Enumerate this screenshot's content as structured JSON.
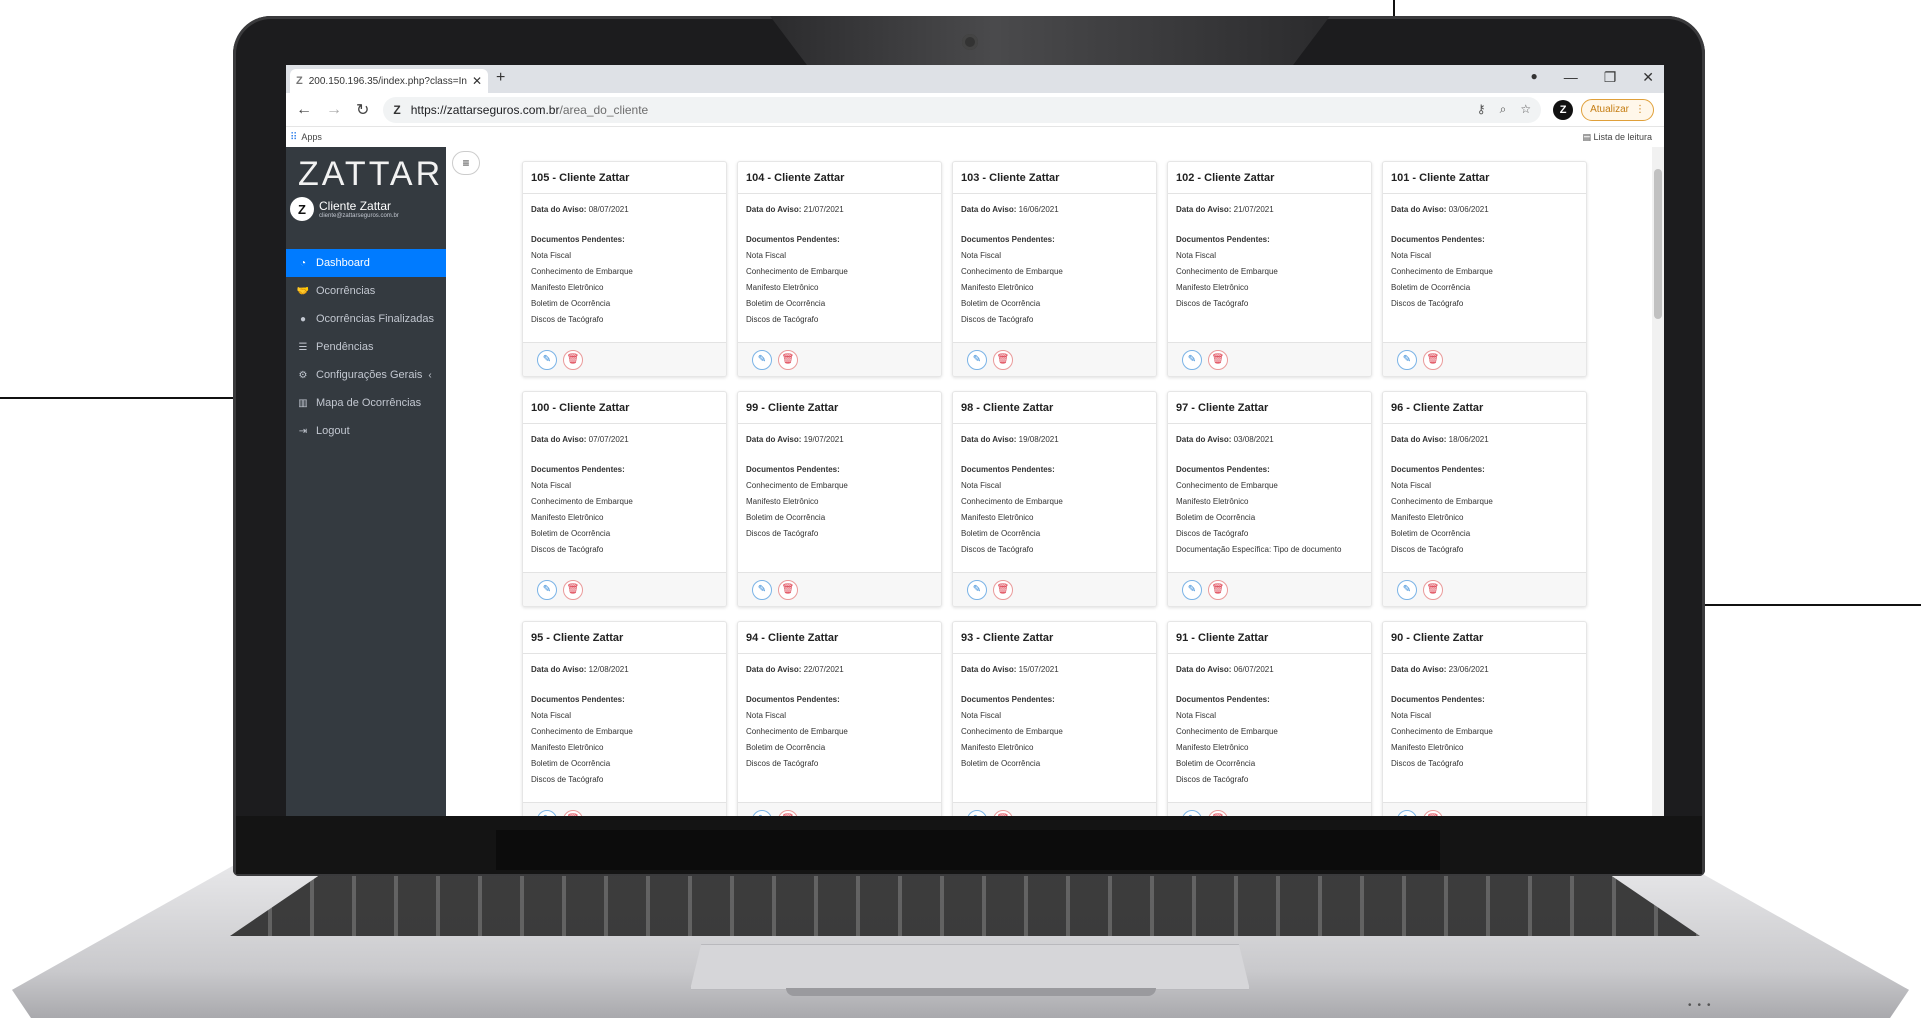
{
  "browser": {
    "tab_title": "200.150.196.35/index.php?class=In",
    "tab_favicon": "Z",
    "new_tab": "+",
    "url_host": "https://zattarseguros.com.br",
    "url_path": "/area_do_cliente",
    "url_favicon": "Z",
    "profile_initial": "Z",
    "update_label": "Atualizar",
    "bookmarks_apps": "Apps",
    "reading_list": "Lista de leitura"
  },
  "sidebar": {
    "brand": "ZATTAR",
    "user_initial": "Z",
    "user_name": "Cliente Zattar",
    "user_email": "cliente@zattarseguros.com.br",
    "items": [
      {
        "label": "Dashboard",
        "icon": "chart-pie-icon",
        "active": true
      },
      {
        "label": "Ocorrências",
        "icon": "handshake-icon"
      },
      {
        "label": "Ocorrências Finalizadas",
        "icon": "circle-icon"
      },
      {
        "label": "Pendências",
        "icon": "list-icon"
      },
      {
        "label": "Configurações Gerais",
        "icon": "gear-icon",
        "chevron": "‹"
      },
      {
        "label": "Mapa de Ocorrências",
        "icon": "map-icon"
      },
      {
        "label": "Logout",
        "icon": "logout-icon"
      }
    ]
  },
  "labels": {
    "date_label": "Data do Aviso:",
    "docs_label": "Documentos Pendentes:"
  },
  "cards": [
    {
      "title": "105 - Cliente Zattar",
      "date": "08/07/2021",
      "docs": [
        "Nota Fiscal",
        "Conhecimento de Embarque",
        "Manifesto Eletrônico",
        "Boletim de Ocorrência",
        "Discos de Tacógrafo"
      ]
    },
    {
      "title": "104 - Cliente Zattar",
      "date": "21/07/2021",
      "docs": [
        "Nota Fiscal",
        "Conhecimento de Embarque",
        "Manifesto Eletrônico",
        "Boletim de Ocorrência",
        "Discos de Tacógrafo"
      ]
    },
    {
      "title": "103 - Cliente Zattar",
      "date": "16/06/2021",
      "docs": [
        "Nota Fiscal",
        "Conhecimento de Embarque",
        "Manifesto Eletrônico",
        "Boletim de Ocorrência",
        "Discos de Tacógrafo"
      ]
    },
    {
      "title": "102 - Cliente Zattar",
      "date": "21/07/2021",
      "docs": [
        "Nota Fiscal",
        "Conhecimento de Embarque",
        "Manifesto Eletrônico",
        "Discos de Tacógrafo"
      ]
    },
    {
      "title": "101 - Cliente Zattar",
      "date": "03/06/2021",
      "docs": [
        "Nota Fiscal",
        "Conhecimento de Embarque",
        "Boletim de Ocorrência",
        "Discos de Tacógrafo"
      ]
    },
    {
      "title": "100 - Cliente Zattar",
      "date": "07/07/2021",
      "docs": [
        "Nota Fiscal",
        "Conhecimento de Embarque",
        "Manifesto Eletrônico",
        "Boletim de Ocorrência",
        "Discos de Tacógrafo"
      ]
    },
    {
      "title": "99 - Cliente Zattar",
      "date": "19/07/2021",
      "docs": [
        "Conhecimento de Embarque",
        "Manifesto Eletrônico",
        "Boletim de Ocorrência",
        "Discos de Tacógrafo"
      ]
    },
    {
      "title": "98 - Cliente Zattar",
      "date": "19/08/2021",
      "docs": [
        "Nota Fiscal",
        "Conhecimento de Embarque",
        "Manifesto Eletrônico",
        "Boletim de Ocorrência",
        "Discos de Tacógrafo"
      ]
    },
    {
      "title": "97 - Cliente Zattar",
      "date": "03/08/2021",
      "docs": [
        "Conhecimento de Embarque",
        "Manifesto Eletrônico",
        "Boletim de Ocorrência",
        "Discos de Tacógrafo",
        "Documentação Específica: Tipo de documento"
      ]
    },
    {
      "title": "96 - Cliente Zattar",
      "date": "18/06/2021",
      "docs": [
        "Nota Fiscal",
        "Conhecimento de Embarque",
        "Manifesto Eletrônico",
        "Boletim de Ocorrência",
        "Discos de Tacógrafo"
      ]
    },
    {
      "title": "95 - Cliente Zattar",
      "date": "12/08/2021",
      "docs": [
        "Nota Fiscal",
        "Conhecimento de Embarque",
        "Manifesto Eletrônico",
        "Boletim de Ocorrência",
        "Discos de Tacógrafo"
      ]
    },
    {
      "title": "94 - Cliente Zattar",
      "date": "22/07/2021",
      "docs": [
        "Nota Fiscal",
        "Conhecimento de Embarque",
        "Boletim de Ocorrência",
        "Discos de Tacógrafo"
      ]
    },
    {
      "title": "93 - Cliente Zattar",
      "date": "15/07/2021",
      "docs": [
        "Nota Fiscal",
        "Conhecimento de Embarque",
        "Manifesto Eletrônico",
        "Boletim de Ocorrência"
      ]
    },
    {
      "title": "91 - Cliente Zattar",
      "date": "06/07/2021",
      "docs": [
        "Nota Fiscal",
        "Conhecimento de Embarque",
        "Manifesto Eletrônico",
        "Boletim de Ocorrência",
        "Discos de Tacógrafo"
      ]
    },
    {
      "title": "90 - Cliente Zattar",
      "date": "23/06/2021",
      "docs": [
        "Nota Fiscal",
        "Conhecimento de Embarque",
        "Manifesto Eletrônico",
        "Discos de Tacógrafo"
      ]
    }
  ],
  "colors": {
    "sidebar_bg": "#343a40",
    "active_item": "#007bff",
    "edit_button": "#2e86d6",
    "delete_button": "#dc3545",
    "update_button": "#c57d12"
  }
}
